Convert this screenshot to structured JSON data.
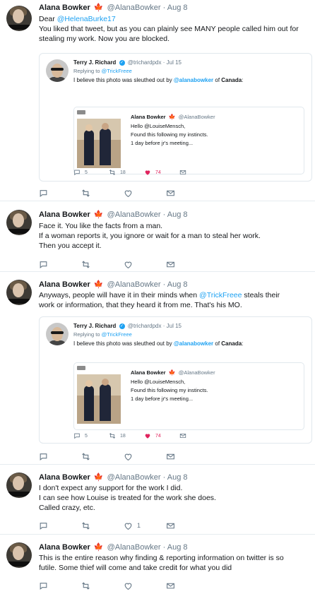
{
  "tweets": [
    {
      "name": "Alana Bowker",
      "handle": "@AlanaBowker",
      "date": "· Aug 8",
      "lines": [
        {
          "pre": "Dear ",
          "link": "@HelenaBurke17",
          "post": ""
        },
        {
          "pre": "You liked that tweet, but as you can plainly see MANY people called him out for",
          "link": "",
          "post": ""
        },
        {
          "pre": "stealing my work. Now you are blocked.",
          "link": "",
          "post": ""
        }
      ],
      "actions": {
        "reply": "",
        "retweet": "",
        "like": "",
        "dm": ""
      }
    },
    {
      "name": "Alana Bowker",
      "handle": "@AlanaBowker",
      "date": "· Aug 8",
      "lines": [
        {
          "pre": "Face it. You like the facts from a man."
        },
        {
          "pre": "If a woman reports it, you ignore or wait for a man to steal her work."
        },
        {
          "pre": "Then you accept it."
        }
      ],
      "actions": {
        "reply": "",
        "retweet": "",
        "like": "",
        "dm": ""
      }
    },
    {
      "name": "Alana Bowker",
      "handle": "@AlanaBowker",
      "date": "· Aug 8",
      "lines": [
        {
          "pre": "Anyways, people will have it in their minds when ",
          "link": "@TrickFreee",
          "post": " steals their"
        },
        {
          "pre": "work or information, that they heard it from me. That's his MO.",
          "link": "",
          "post": ""
        }
      ],
      "actions": {
        "reply": "",
        "retweet": "",
        "like": "",
        "dm": ""
      }
    },
    {
      "name": "Alana Bowker",
      "handle": "@AlanaBowker",
      "date": "· Aug 8",
      "lines": [
        {
          "pre": "I don't expect any support for the work I did."
        },
        {
          "pre": "I can see how Louise is treated for the work she does."
        },
        {
          "pre": "Called crazy, etc."
        }
      ],
      "actions": {
        "reply": "",
        "retweet": "",
        "like": "1",
        "dm": ""
      }
    },
    {
      "name": "Alana Bowker",
      "handle": "@AlanaBowker",
      "date": "· Aug 8",
      "lines": [
        {
          "pre": "This is the entire reason why finding & reporting information on twitter is so"
        },
        {
          "pre": "futile. Some thief will come and take credit for what you did"
        }
      ],
      "actions": {
        "reply": "",
        "retweet": "",
        "like": "",
        "dm": ""
      }
    }
  ],
  "quotes": [
    {
      "name": "Terry J. Richard",
      "handle": "@trichardpdx",
      "date": "· Jul 15",
      "replying_prefix": "Replying to ",
      "replying_to": "@TrickFreee",
      "text_pre": "I believe this photo was sleuthed out by ",
      "text_mention": "@alanabowker",
      "text_mid": " of ",
      "text_bold": "Canada",
      "text_post": ":",
      "inner": {
        "name": "Alana Bowker",
        "handle": "@AlanaBowker",
        "lines": [
          "Hello @LouiseMensch,",
          "Found this following my instincts.",
          "1 day before jr's meeting..."
        ]
      },
      "counts": {
        "reply": "5",
        "retweet": "18",
        "like": "74"
      }
    },
    {
      "name": "Terry J. Richard",
      "handle": "@trichardpdx",
      "date": "· Jul 15",
      "replying_prefix": "Replying to ",
      "replying_to": "@TrickFreee",
      "text_pre": "I believe this photo was sleuthed out by ",
      "text_mention": "@alanabowker",
      "text_mid": " of ",
      "text_bold": "Canada",
      "text_post": ":",
      "inner": {
        "name": "Alana Bowker",
        "handle": "@AlanaBowker",
        "lines": [
          "Hello @LouiseMensch,",
          "Found this following my instincts.",
          "1 day before jr's meeting..."
        ]
      },
      "counts": {
        "reply": "5",
        "retweet": "18",
        "like": "74"
      }
    }
  ],
  "avatar_band_text": "",
  "colors": {
    "link": "#1da1f2",
    "like": "#e0245e",
    "muted": "#657786",
    "border": "#e6ecf0"
  },
  "icons": {
    "reply": "reply-icon",
    "retweet": "retweet-icon",
    "like": "heart-icon",
    "dm": "envelope-icon",
    "leaf": "maple-leaf-icon",
    "verified": "verified-badge-icon"
  }
}
